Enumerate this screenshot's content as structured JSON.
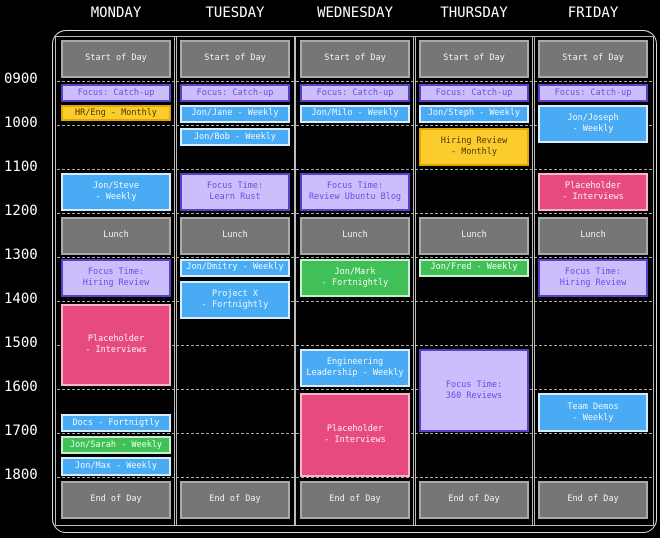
{
  "days": [
    {
      "name": "MONDAY",
      "events": [
        {
          "label": "Start of Day",
          "start": 8.07,
          "end": 8.93,
          "kind": "gray"
        },
        {
          "label": "Focus: Catch-up",
          "start": 9.07,
          "end": 9.48,
          "kind": "lav"
        },
        {
          "label": "HR/Eng - Monthly",
          "start": 9.55,
          "end": 9.91,
          "kind": "yel"
        },
        {
          "label": "Jon/Steve\n- Weekly",
          "start": 11.09,
          "end": 11.95,
          "kind": "blue"
        },
        {
          "label": "Lunch",
          "start": 12.09,
          "end": 12.95,
          "kind": "gray"
        },
        {
          "label": "Focus Time:\nHiring Review",
          "start": 13.05,
          "end": 13.91,
          "kind": "lav"
        },
        {
          "label": "Placeholder\n- Interviews",
          "start": 14.07,
          "end": 15.93,
          "kind": "pink"
        },
        {
          "label": "Docs - Fortnigtly",
          "start": 16.57,
          "end": 16.98,
          "kind": "blue"
        },
        {
          "label": "Jon/Sarah - Weekly",
          "start": 17.07,
          "end": 17.48,
          "kind": "green"
        },
        {
          "label": "Jon/Max - Weekly",
          "start": 17.55,
          "end": 17.98,
          "kind": "blue"
        },
        {
          "label": "End of Day",
          "start": 18.09,
          "end": 18.95,
          "kind": "gray"
        }
      ]
    },
    {
      "name": "TUESDAY",
      "events": [
        {
          "label": "Start of Day",
          "start": 8.07,
          "end": 8.93,
          "kind": "gray"
        },
        {
          "label": "Focus: Catch-up",
          "start": 9.07,
          "end": 9.48,
          "kind": "lav"
        },
        {
          "label": "Jon/Jane - Weekly",
          "start": 9.55,
          "end": 9.95,
          "kind": "blue"
        },
        {
          "label": "Jon/Bob - Weekly",
          "start": 10.07,
          "end": 10.48,
          "kind": "blue"
        },
        {
          "label": "Focus Time:\nLearn Rust",
          "start": 11.09,
          "end": 11.95,
          "kind": "lav"
        },
        {
          "label": "Lunch",
          "start": 12.09,
          "end": 12.95,
          "kind": "gray"
        },
        {
          "label": "Jon/Dmitry - Weekly",
          "start": 13.05,
          "end": 13.45,
          "kind": "blue"
        },
        {
          "label": "Project X\n- Fortnightly",
          "start": 13.55,
          "end": 14.41,
          "kind": "blue"
        },
        {
          "label": "End of Day",
          "start": 18.09,
          "end": 18.95,
          "kind": "gray"
        }
      ]
    },
    {
      "name": "WEDNESDAY",
      "events": [
        {
          "label": "Start of Day",
          "start": 8.07,
          "end": 8.93,
          "kind": "gray"
        },
        {
          "label": "Focus: Catch-up",
          "start": 9.07,
          "end": 9.48,
          "kind": "lav"
        },
        {
          "label": "Jon/Milo - Weekly",
          "start": 9.55,
          "end": 9.95,
          "kind": "blue"
        },
        {
          "label": "Focus Time:\nReview Ubuntu Blog",
          "start": 11.09,
          "end": 11.95,
          "kind": "lav"
        },
        {
          "label": "Lunch",
          "start": 12.09,
          "end": 12.95,
          "kind": "gray"
        },
        {
          "label": "Jon/Mark\n- Fortnightly",
          "start": 13.05,
          "end": 13.91,
          "kind": "green"
        },
        {
          "label": "Engineering\nLeadership - Weekly",
          "start": 15.09,
          "end": 15.95,
          "kind": "blue"
        },
        {
          "label": "Placeholder\n- Interviews",
          "start": 16.09,
          "end": 18.0,
          "kind": "pink"
        },
        {
          "label": "End of Day",
          "start": 18.09,
          "end": 18.95,
          "kind": "gray"
        }
      ]
    },
    {
      "name": "THURSDAY",
      "events": [
        {
          "label": "Start of Day",
          "start": 8.07,
          "end": 8.93,
          "kind": "gray"
        },
        {
          "label": "Focus: Catch-up",
          "start": 9.07,
          "end": 9.48,
          "kind": "lav"
        },
        {
          "label": "Jon/Steph - Weekly",
          "start": 9.55,
          "end": 9.95,
          "kind": "blue"
        },
        {
          "label": "Hiring Review\n- Monthly",
          "start": 10.07,
          "end": 10.93,
          "kind": "yel"
        },
        {
          "label": "Lunch",
          "start": 12.09,
          "end": 12.95,
          "kind": "gray"
        },
        {
          "label": "Jon/Fred - Weekly",
          "start": 13.05,
          "end": 13.45,
          "kind": "green"
        },
        {
          "label": "Focus Time:\n360 Reviews",
          "start": 15.09,
          "end": 16.98,
          "kind": "lav"
        },
        {
          "label": "End of Day",
          "start": 18.09,
          "end": 18.95,
          "kind": "gray"
        }
      ]
    },
    {
      "name": "FRIDAY",
      "events": [
        {
          "label": "Start of Day",
          "start": 8.07,
          "end": 8.93,
          "kind": "gray"
        },
        {
          "label": "Focus: Catch-up",
          "start": 9.07,
          "end": 9.48,
          "kind": "lav"
        },
        {
          "label": "Jon/Joseph\n- Weekly",
          "start": 9.55,
          "end": 10.41,
          "kind": "blue"
        },
        {
          "label": "Placeholder\n- Interviews",
          "start": 11.09,
          "end": 11.95,
          "kind": "pink"
        },
        {
          "label": "Lunch",
          "start": 12.09,
          "end": 12.95,
          "kind": "gray"
        },
        {
          "label": "Focus Time:\nHiring Review",
          "start": 13.05,
          "end": 13.91,
          "kind": "lav"
        },
        {
          "label": "Team Demos\n- Weekly",
          "start": 16.09,
          "end": 16.98,
          "kind": "blue"
        },
        {
          "label": "End of Day",
          "start": 18.09,
          "end": 18.95,
          "kind": "gray"
        }
      ]
    }
  ],
  "hours": [
    "0900",
    "1000",
    "1100",
    "1200",
    "1300",
    "1400",
    "1500",
    "1600",
    "1700",
    "1800"
  ],
  "colors": {
    "gray": "#767676",
    "lavender": "#ccbefc",
    "yellow": "#fccb2e",
    "blue": "#4aabf5",
    "pink": "#e64a80",
    "green": "#40c057"
  }
}
